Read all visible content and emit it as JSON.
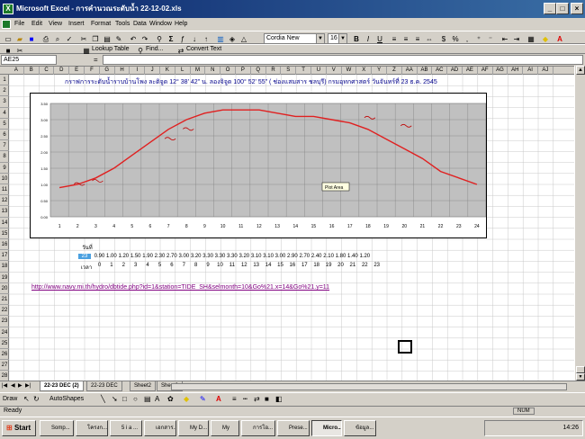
{
  "window": {
    "title": "Microsoft Excel - การคำนวณระดับน้ำ 22-12-02.xls",
    "min": "_",
    "max": "□",
    "close": "×"
  },
  "menu": [
    "File",
    "Edit",
    "View",
    "Insert",
    "Format",
    "Tools",
    "Data",
    "Window",
    "Help"
  ],
  "toolbar": {
    "font": "Cordia New",
    "size": "16",
    "bold": "B",
    "italic": "I",
    "underline": "U"
  },
  "toolbar2": {
    "lookup": "Lookup Table",
    "find": "Find...",
    "convert": "Convert Text"
  },
  "namebox": "AE25",
  "formula_eq": "=",
  "columns": [
    "A",
    "B",
    "C",
    "D",
    "E",
    "F",
    "G",
    "H",
    "I",
    "J",
    "K",
    "L",
    "M",
    "N",
    "O",
    "P",
    "Q",
    "R",
    "S",
    "T",
    "U",
    "V",
    "W",
    "X",
    "Y",
    "Z",
    "AA",
    "AB",
    "AC",
    "AD",
    "AE",
    "AF",
    "AG",
    "AH",
    "AI",
    "AJ"
  ],
  "rows": [
    "1",
    "2",
    "3",
    "4",
    "5",
    "6",
    "7",
    "8",
    "9",
    "10",
    "11",
    "12",
    "13",
    "14",
    "15",
    "16",
    "17",
    "18",
    "19",
    "20",
    "21",
    "22",
    "23",
    "24",
    "25",
    "26",
    "27",
    "28"
  ],
  "sheet_title": "กราฟการระดับน้ำราบบ้านโพง ละติจูด 12° 38' 42\" น. ลองจิจูด 100° 52' 55\" ( ช่องแสมสาร ชลบุรี) กรมอุทกศาสตร์ วันจันทร์ที่ 23 ธ.ค. 2545",
  "table": {
    "label_day": "วันที่",
    "day": "23",
    "label_level": "ระดับ",
    "label_time": "เวลา",
    "levels": [
      "0.90",
      "1.00",
      "1.20",
      "1.50",
      "1.90",
      "2.30",
      "2.70",
      "3.00",
      "3.20",
      "3.30",
      "3.30",
      "3.30",
      "3.20",
      "3.10",
      "3.10",
      "3.00",
      "2.90",
      "2.70",
      "2.40",
      "2.10",
      "1.80",
      "1.40",
      "1.20"
    ],
    "times": [
      "0",
      "1",
      "2",
      "3",
      "4",
      "5",
      "6",
      "7",
      "8",
      "9",
      "10",
      "11",
      "12",
      "13",
      "14",
      "15",
      "16",
      "17",
      "18",
      "19",
      "20",
      "21",
      "22",
      "23"
    ]
  },
  "link": "http://www.navy.mi.th/hydro/dbtide.php?id=1&station=TIDE_SH&selmonth=10&Go%21.x=14&Go%21.y=11",
  "chart_data": {
    "type": "line",
    "x": [
      1,
      2,
      3,
      4,
      5,
      6,
      7,
      8,
      9,
      10,
      11,
      12,
      13,
      14,
      15,
      16,
      17,
      18,
      19,
      20,
      21,
      22,
      23,
      24
    ],
    "series": [
      {
        "values": [
          0.9,
          1.0,
          1.2,
          1.5,
          1.9,
          2.3,
          2.7,
          3.0,
          3.2,
          3.3,
          3.3,
          3.3,
          3.2,
          3.1,
          3.1,
          3.0,
          2.9,
          2.7,
          2.4,
          2.1,
          1.8,
          1.4,
          1.2,
          1.0
        ]
      }
    ],
    "ylim": [
      0,
      3.5
    ],
    "yticks": [
      "3.50",
      "3.00",
      "2.50",
      "2.00",
      "1.50",
      "1.00",
      "0.50",
      "0.00"
    ],
    "xticks": [
      "1",
      "2",
      "3",
      "4",
      "5",
      "6",
      "7",
      "8",
      "9",
      "10",
      "11",
      "12",
      "13",
      "14",
      "15",
      "16",
      "17",
      "18",
      "19",
      "20",
      "21",
      "22",
      "23",
      "24"
    ],
    "tooltip": "Plot Area",
    "color": "#e02020",
    "plot_bg": "#c0c0c0",
    "grid": true
  },
  "sheets": [
    {
      "label": "22-23 DEC (2)",
      "active": true
    },
    {
      "label": "22-23 DEC",
      "active": false
    },
    {
      "label": "Sheet2",
      "active": false
    },
    {
      "label": "Sheet3",
      "active": false
    }
  ],
  "drawbar": {
    "draw": "Draw",
    "autoshapes": "AutoShapes"
  },
  "status": {
    "left": "Ready",
    "num": "NUM"
  },
  "taskbar": {
    "start": "Start",
    "tasks": [
      "Somp...",
      "โครงก...",
      "5 i a ...",
      "เอกสาร...",
      "My D...",
      "My",
      "การโอ...",
      "Prese...",
      "Micro...",
      "ข้อมูล..."
    ],
    "active": 8,
    "time": "14:26"
  }
}
